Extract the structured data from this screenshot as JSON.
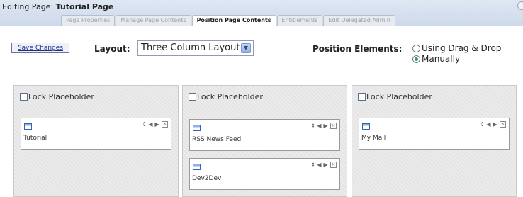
{
  "header": {
    "prefix": "Editing Page:",
    "page_name": "Tutorial Page",
    "tabs": [
      {
        "label": "Page Properties"
      },
      {
        "label": "Manage Page Contents"
      },
      {
        "label": "Position Page Contents"
      },
      {
        "label": "Entitlements"
      },
      {
        "label": "Edit Delegated Admin"
      }
    ],
    "active_tab": "Position Page Contents"
  },
  "toolbar": {
    "save_label": "Save Changes",
    "layout_label": "Layout:",
    "layout_value": "Three Column Layout",
    "position_label": "Position Elements:",
    "options": [
      "Using Drag & Drop",
      "Manually"
    ],
    "selected_option": "Manually"
  },
  "columns": [
    {
      "lock_label": "Lock Placeholder",
      "portlets": [
        "Tutorial"
      ]
    },
    {
      "lock_label": "Lock Placeholder",
      "portlets": [
        "RSS News Feed",
        "Dev2Dev"
      ]
    },
    {
      "lock_label": "Lock Placeholder",
      "portlets": [
        "My Mail"
      ]
    }
  ],
  "portlet_controls": {
    "move": "⇕",
    "left": "◀",
    "right": "▶",
    "close": "×"
  },
  "icons": [
    "portlet-window-icon",
    "move-vertical-icon",
    "arrow-left-icon",
    "arrow-right-icon",
    "close-icon",
    "dropdown-arrow-icon"
  ],
  "colors": {
    "header_bg": "#cdd9eb",
    "column_bg": "#e9e9e9",
    "accent": "#28a64a"
  }
}
